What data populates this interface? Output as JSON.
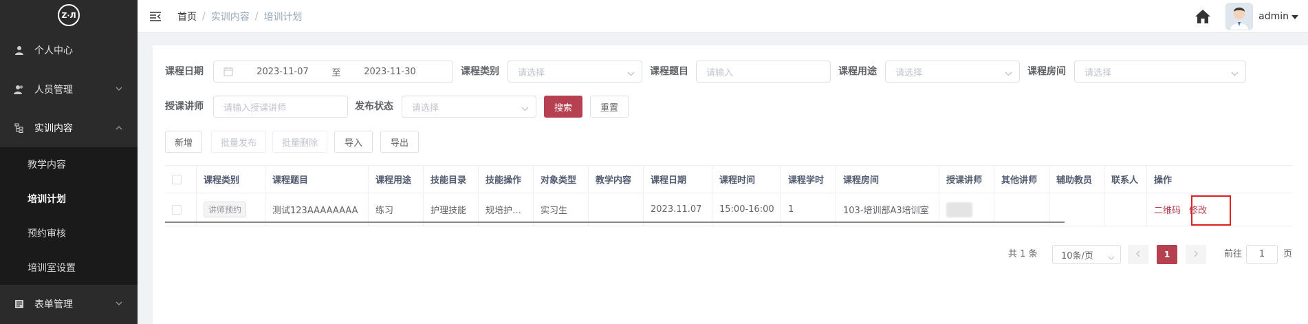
{
  "logo": {
    "text": "Z·Л"
  },
  "sidebar": {
    "items": [
      {
        "label": "个人中心",
        "icon": "user-icon"
      },
      {
        "label": "人员管理",
        "icon": "users-icon"
      },
      {
        "label": "实训内容",
        "icon": "tree-icon"
      },
      {
        "label": "表单管理",
        "icon": "form-icon"
      }
    ],
    "submenu": [
      {
        "label": "教学内容"
      },
      {
        "label": "培训计划"
      },
      {
        "label": "预约审核"
      },
      {
        "label": "培训室设置"
      }
    ]
  },
  "header": {
    "breadcrumb": [
      "首页",
      "实训内容",
      "培训计划"
    ],
    "separator": "/",
    "username": "admin"
  },
  "filters": {
    "course_date_label": "课程日期",
    "date_start": "2023-11-07",
    "date_to": "至",
    "date_end": "2023-11-30",
    "course_type_label": "课程类别",
    "course_type_placeholder": "请选择",
    "course_title_label": "课程题目",
    "course_title_placeholder": "请输入",
    "course_use_label": "课程用途",
    "course_use_placeholder": "请选择",
    "course_room_label": "课程房间",
    "course_room_placeholder": "请选择",
    "lecturer_label": "授课讲师",
    "lecturer_placeholder": "请输入授课讲师",
    "publish_label": "发布状态",
    "publish_placeholder": "请选择",
    "search": "搜索",
    "reset": "重置"
  },
  "toolbar": {
    "add": "新增",
    "batch_publish": "批量发布",
    "batch_delete": "批量删除",
    "import": "导入",
    "export": "导出"
  },
  "table": {
    "headers": [
      "课程类别",
      "课程题目",
      "课程用途",
      "技能目录",
      "技能操作",
      "对象类型",
      "教学内容",
      "课程日期",
      "课程时间",
      "课程学时",
      "课程房间",
      "授课讲师",
      "其他讲师",
      "辅助教员",
      "联系人",
      "操作"
    ],
    "rows": [
      {
        "type": "讲师预约",
        "title": "测试123AAAAAAAA",
        "use": "练习",
        "skill_dir": "护理技能",
        "skill_op": "规培护…",
        "target": "实习生",
        "content": "",
        "date": "2023.11.07",
        "time": "15:00-16:00",
        "hours": "1",
        "room": "103-培训部A3培训室",
        "other": "",
        "assistant": "",
        "contact": "",
        "op_qr": "二维码",
        "op_edit": "修改"
      }
    ]
  },
  "pagination": {
    "total": "共 1 条",
    "page_size": "10条/页",
    "current": "1",
    "goto_label": "前往",
    "goto_value": "1",
    "page_suffix": "页"
  },
  "colors": {
    "primary": "#b5404f",
    "sidebar": "#2b2b2b",
    "highlight": "#e02020"
  }
}
